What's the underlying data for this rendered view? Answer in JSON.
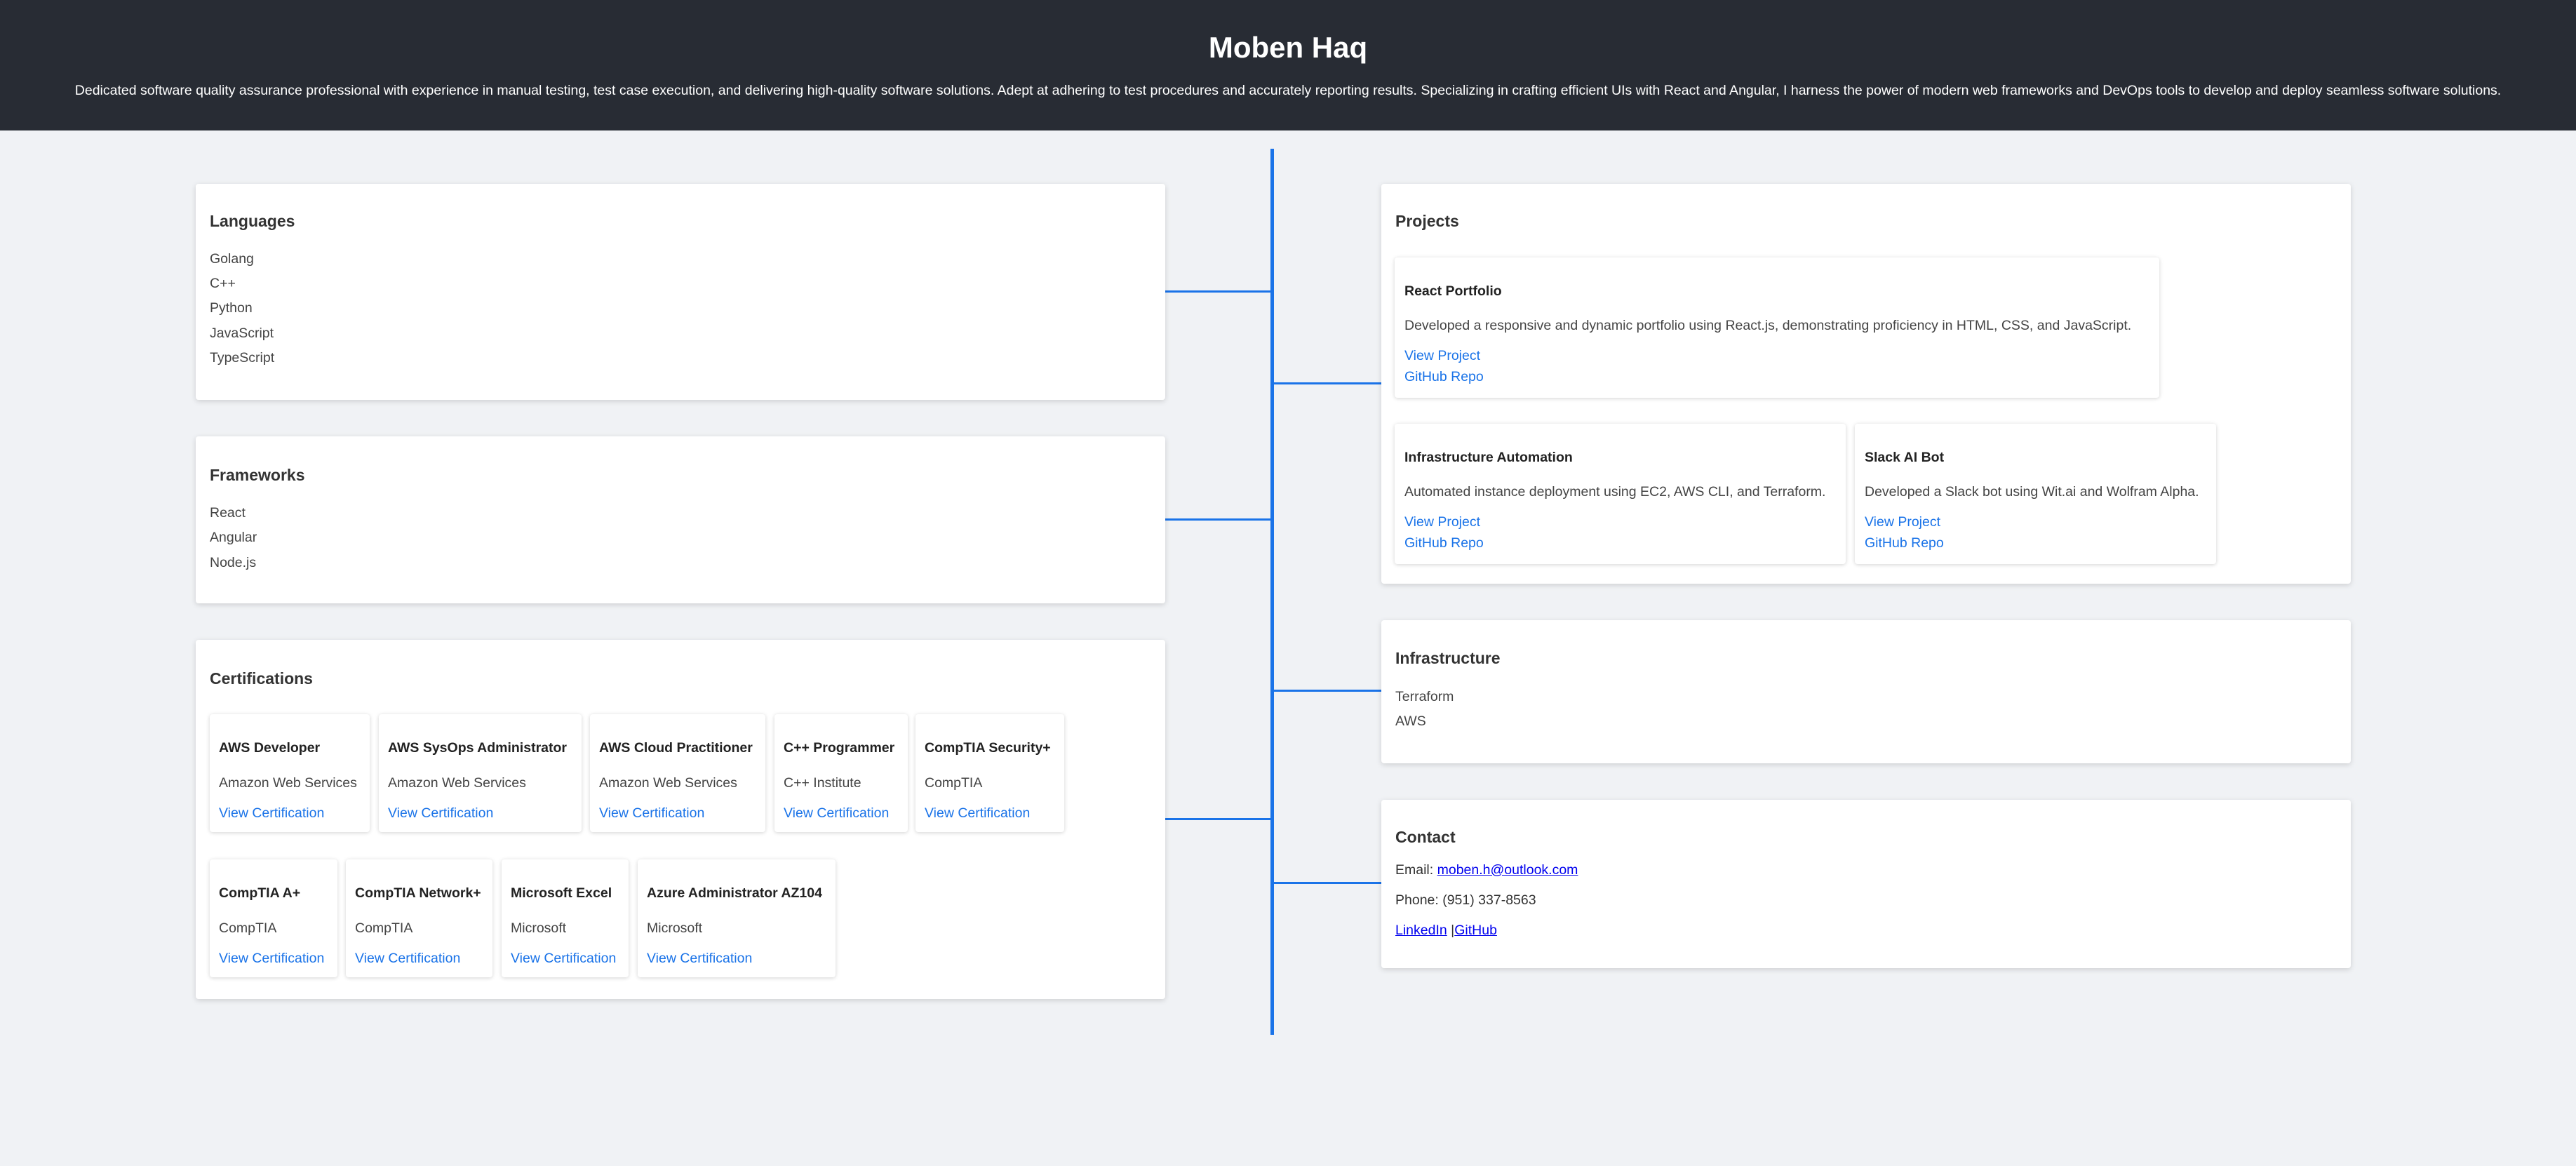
{
  "header": {
    "name": "Moben Haq",
    "summary": "Dedicated software quality assurance professional with experience in manual testing, test case execution, and delivering high-quality software solutions. Adept at adhering to test procedures and accurately reporting results. Specializing in crafting efficient UIs with React and Angular, I harness the power of modern web frameworks and DevOps tools to develop and deploy seamless software solutions."
  },
  "languages": {
    "title": "Languages",
    "items": [
      "Golang",
      "C++",
      "Python",
      "JavaScript",
      "TypeScript"
    ]
  },
  "frameworks": {
    "title": "Frameworks",
    "items": [
      "React",
      "Angular",
      "Node.js"
    ]
  },
  "certifications": {
    "title": "Certifications",
    "link_label": "View Certification",
    "items": [
      {
        "name": "AWS Developer",
        "org": "Amazon Web Services"
      },
      {
        "name": "AWS SysOps Administrator",
        "org": "Amazon Web Services"
      },
      {
        "name": "AWS Cloud Practitioner",
        "org": "Amazon Web Services"
      },
      {
        "name": "C++ Programmer",
        "org": "C++ Institute"
      },
      {
        "name": "CompTIA Security+",
        "org": "CompTIA"
      },
      {
        "name": "CompTIA A+",
        "org": "CompTIA"
      },
      {
        "name": "CompTIA Network+",
        "org": "CompTIA"
      },
      {
        "name": "Microsoft Excel",
        "org": "Microsoft"
      },
      {
        "name": "Azure Administrator AZ104",
        "org": "Microsoft"
      }
    ]
  },
  "projects": {
    "title": "Projects",
    "view_label": "View Project",
    "repo_label": "GitHub Repo",
    "items": [
      {
        "name": "React Portfolio",
        "desc": "Developed a responsive and dynamic portfolio using React.js, demonstrating proficiency in HTML, CSS, and JavaScript."
      },
      {
        "name": "Infrastructure Automation",
        "desc": "Automated instance deployment using EC2, AWS CLI, and Terraform."
      },
      {
        "name": "Slack AI Bot",
        "desc": "Developed a Slack bot using Wit.ai and Wolfram Alpha."
      }
    ]
  },
  "infrastructure": {
    "title": "Infrastructure",
    "items": [
      "Terraform",
      "AWS"
    ]
  },
  "contact": {
    "title": "Contact",
    "email_label": "Email: ",
    "email": "moben.h@outlook.com",
    "phone": "Phone: (951) 337-8563",
    "linkedin": "LinkedIn",
    "separator": " |",
    "github": "GitHub"
  },
  "colors": {
    "header_bg": "#282c34",
    "accent": "#1a73e8",
    "page_bg": "#f0f2f5"
  }
}
